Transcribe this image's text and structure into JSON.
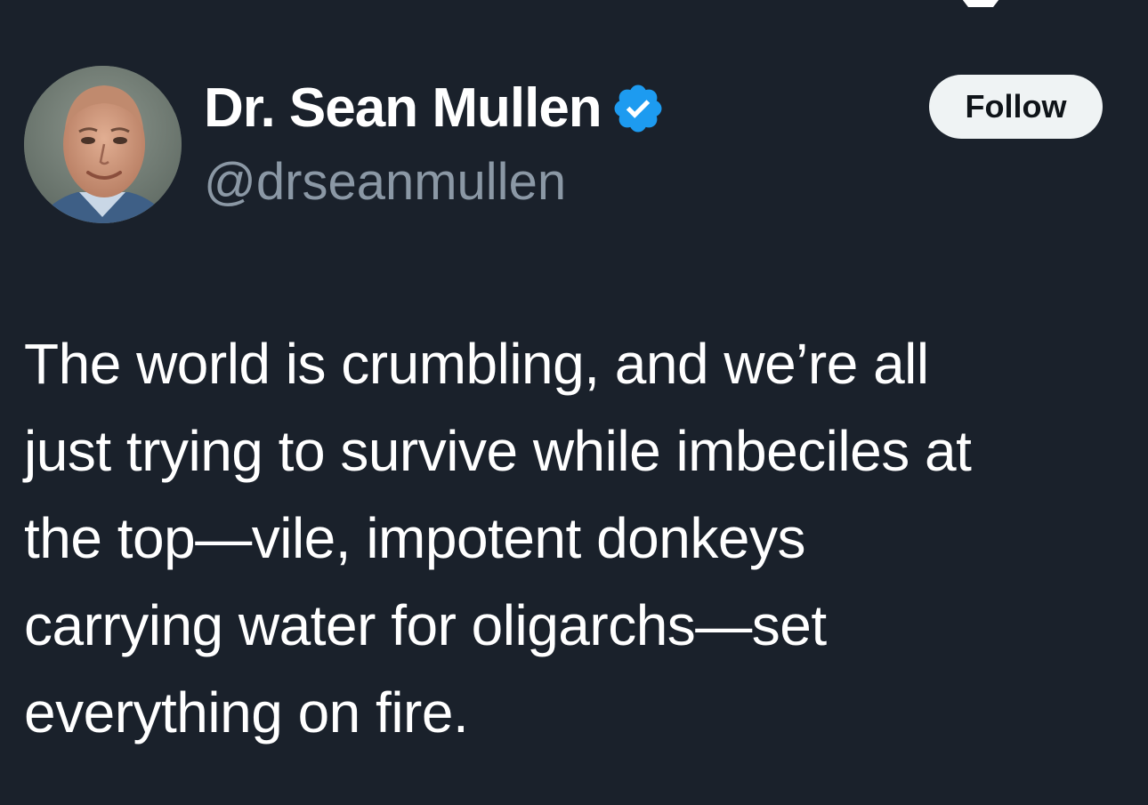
{
  "author": {
    "display_name": "Dr. Sean Mullen",
    "handle": "@drseanmullen",
    "verified": true,
    "avatar_icon": "avatar-photo"
  },
  "actions": {
    "follow_label": "Follow"
  },
  "tweet": {
    "text": "The world is crumbling, and we’re all\njust trying to survive while imbeciles at\nthe top—vile, impotent donkeys\ncarrying water for oligarchs—set\neverything on fire."
  },
  "colors": {
    "background": "#1a212b",
    "text_primary": "#ffffff",
    "text_secondary": "#8b98a5",
    "verified_badge": "#1d9bf0",
    "follow_button_bg": "#eff3f4",
    "follow_button_text": "#0f1419"
  },
  "icons": {
    "verified": "verified-badge-icon",
    "top_logo": "x-logo-icon"
  }
}
